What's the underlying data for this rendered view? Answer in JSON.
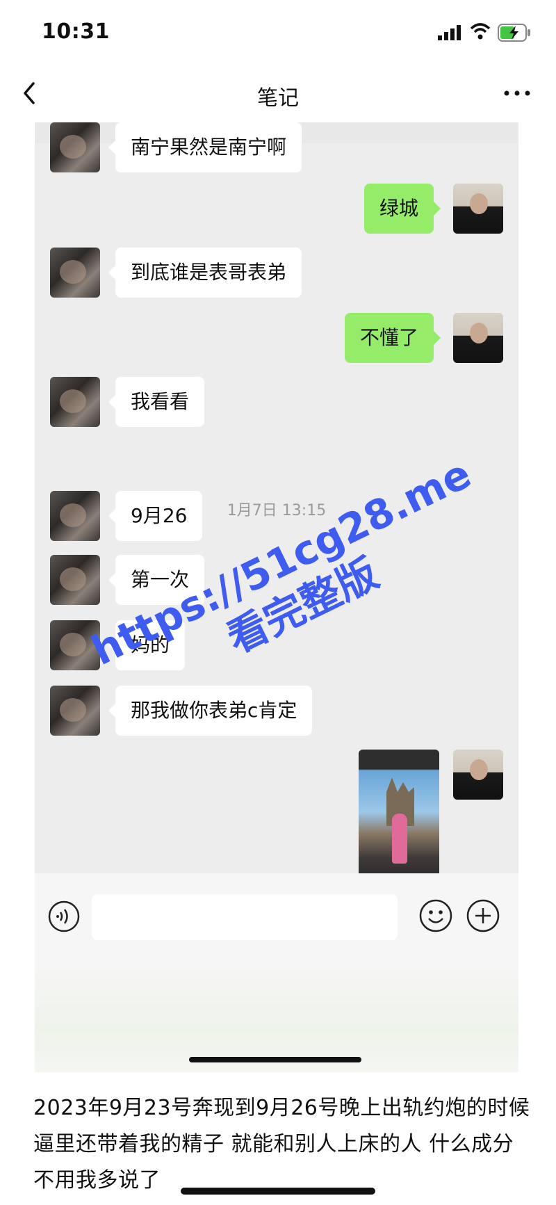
{
  "status_bar": {
    "time": "10:31"
  },
  "nav": {
    "title": "笔记"
  },
  "chat": {
    "messages": [
      {
        "side": "left",
        "text": "南宁果然是南宁啊"
      },
      {
        "side": "right",
        "text": "绿城"
      },
      {
        "side": "left",
        "text": "到底谁是表哥表弟"
      },
      {
        "side": "right",
        "text": "不懂了"
      },
      {
        "side": "left",
        "text": "我看看"
      },
      {
        "side": "left",
        "text": "9月26"
      },
      {
        "side": "left",
        "text": "第一次"
      },
      {
        "side": "left",
        "text": "妈的"
      },
      {
        "side": "left",
        "text": "那我做你表弟c肯定"
      }
    ],
    "timestamp": "1月7日 13:15"
  },
  "caption": "2023年9月23号奔现到9月26号晚上出轨约炮的时候 逼里还带着我的精子 就能和别人上床的人 什么成分 不用我多说了",
  "watermark": {
    "url": "https://51cg28.me",
    "text": "看完整版"
  },
  "colors": {
    "accent": "#95ec69",
    "watermark": "#3f5cf0",
    "chat_bg": "#ededed"
  }
}
